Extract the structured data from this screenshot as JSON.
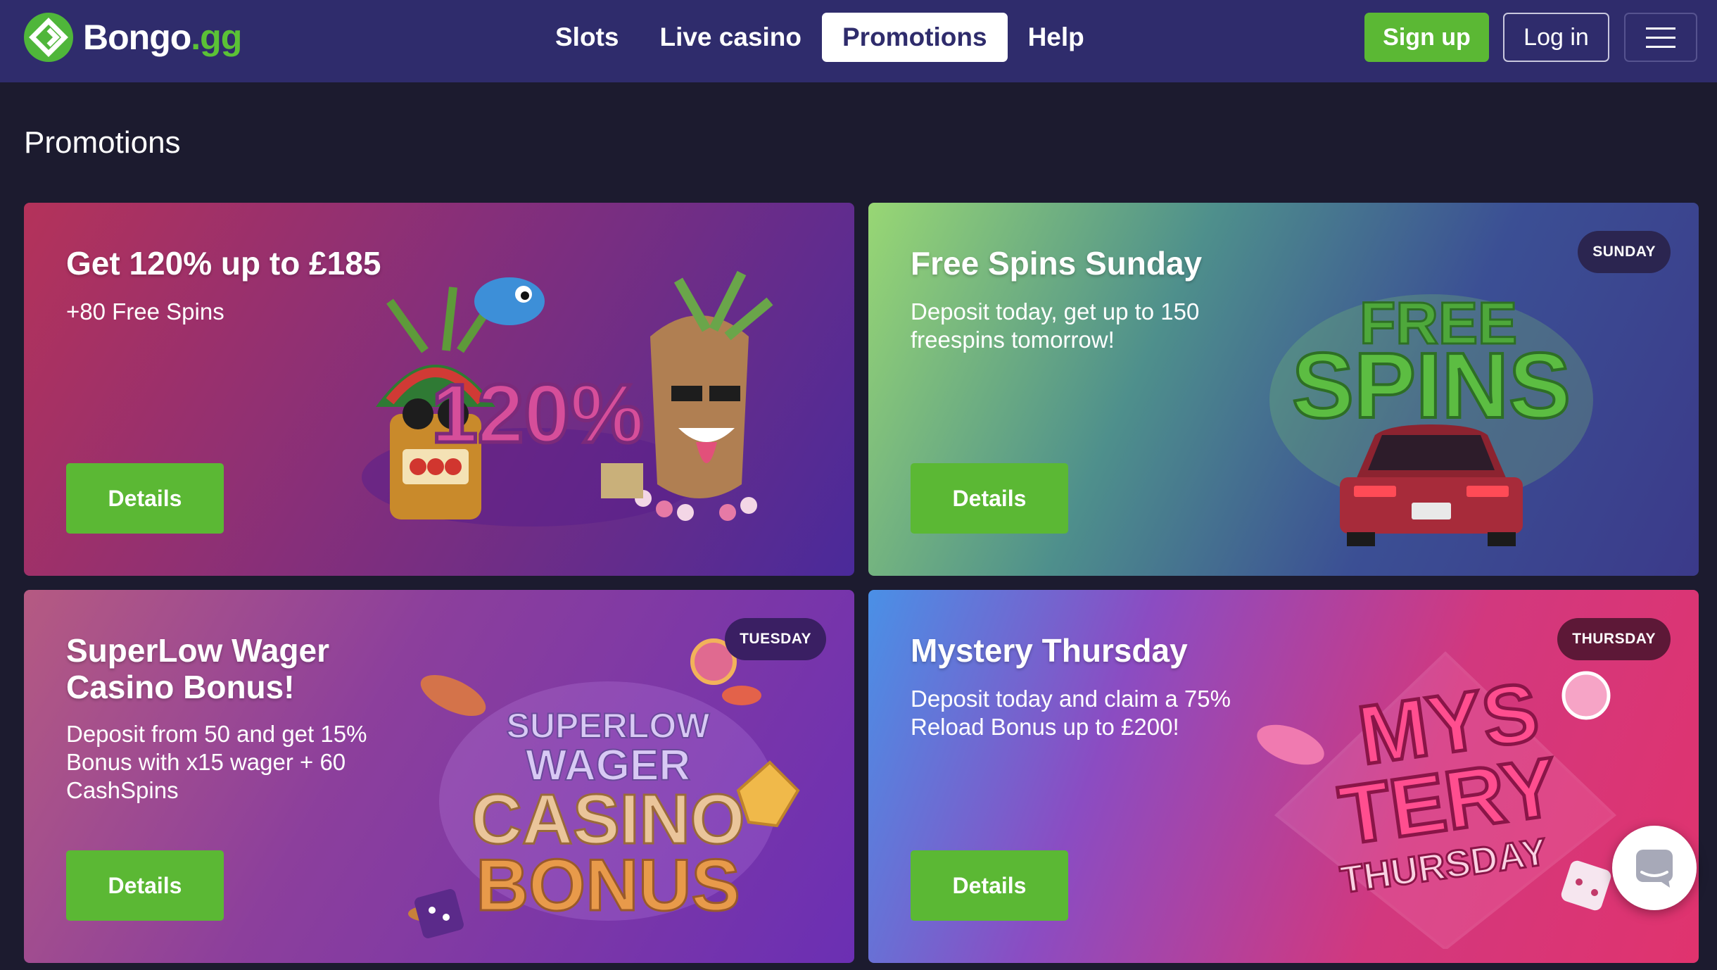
{
  "header": {
    "logo": {
      "name": "Bongo",
      "suffix": ".gg"
    },
    "nav": [
      {
        "label": "Slots",
        "active": false
      },
      {
        "label": "Live casino",
        "active": false
      },
      {
        "label": "Promotions",
        "active": true
      },
      {
        "label": "Help",
        "active": false
      }
    ],
    "signup_label": "Sign up",
    "login_label": "Log in"
  },
  "page": {
    "title": "Promotions"
  },
  "promotions": [
    {
      "title": "Get 120% up to £185",
      "description": "+80 Free Spins",
      "button": "Details",
      "badge": "",
      "art_text": [
        "120%"
      ]
    },
    {
      "title": "Free Spins Sunday",
      "description": "Deposit today, get up to 150 freespins tomorrow!",
      "button": "Details",
      "badge": "SUNDAY",
      "art_text": [
        "FREE",
        "SPINS"
      ]
    },
    {
      "title": "SuperLow Wager Casino Bonus!",
      "description": "Deposit from 50 and get 15% Bonus with x15 wager + 60 CashSpins",
      "button": "Details",
      "badge": "TUESDAY",
      "art_text": [
        "SUPERLOW",
        "WAGER",
        "CASINO",
        "BONUS"
      ]
    },
    {
      "title": "Mystery Thursday",
      "description": "Deposit today and claim a 75% Reload Bonus up to £200!",
      "button": "Details",
      "badge": "THURSDAY",
      "art_text": [
        "MYS",
        "TERY",
        "THURSDAY"
      ]
    }
  ],
  "colors": {
    "header_bg": "#2f2c6c",
    "page_bg": "#1c1b2f",
    "accent_green": "#5bb834"
  },
  "icons": {
    "logo": "bongo-logo-icon",
    "menu": "hamburger-menu-icon",
    "chat": "chat-bubble-icon"
  }
}
